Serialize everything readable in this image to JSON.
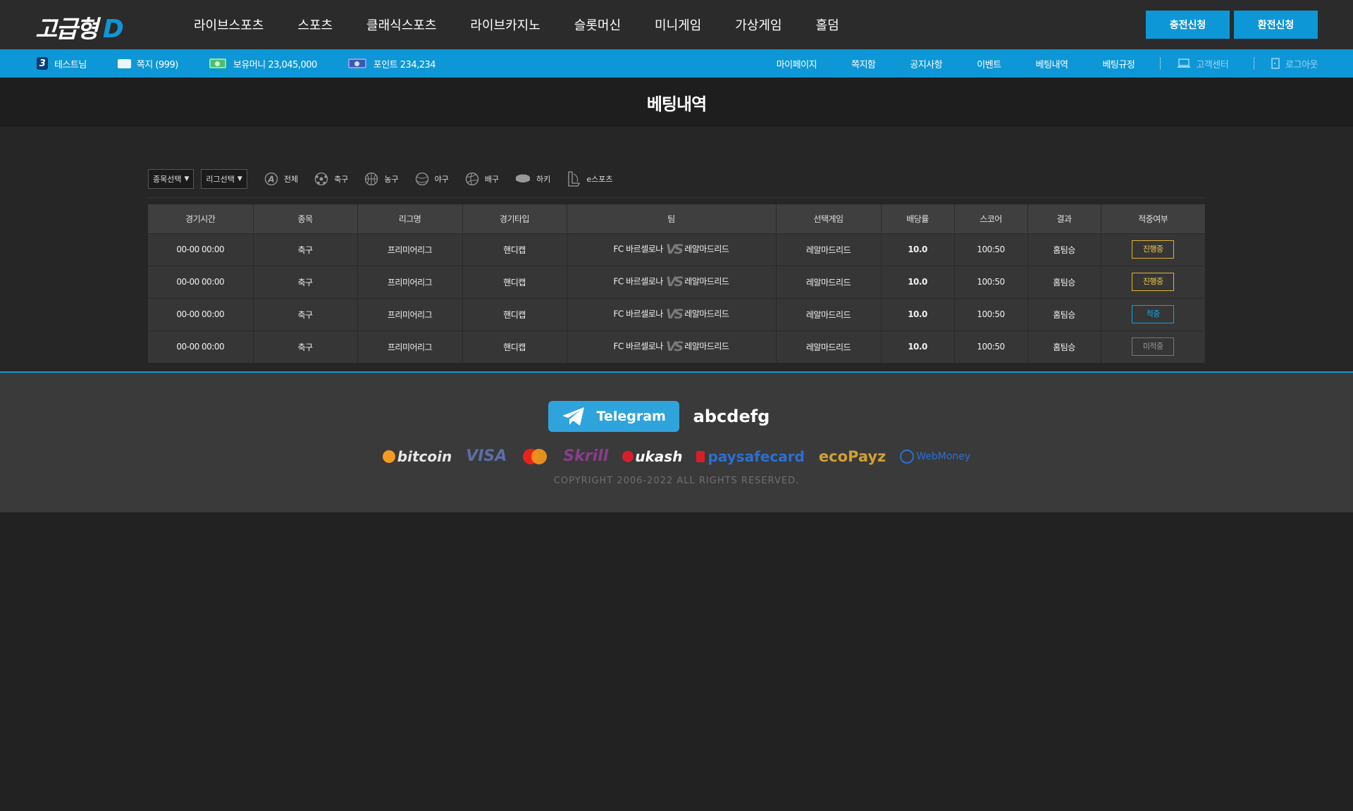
{
  "brand": {
    "logo_text": "고급형",
    "logo_letter": "D"
  },
  "main_nav": [
    "라이브스포츠",
    "스포츠",
    "클래식스포츠",
    "라이브카지노",
    "슬롯머신",
    "미니게임",
    "가상게임",
    "홀덤"
  ],
  "top_buttons": {
    "deposit": "충전신청",
    "withdraw": "환전신청"
  },
  "user_bar": {
    "level": "3",
    "username": "테스트님",
    "messages": "쪽지 (999)",
    "money": "보유머니 23,045,000",
    "points": "포인트 234,234"
  },
  "sub_nav": [
    "마이페이지",
    "쪽지함",
    "공지사항",
    "이벤트",
    "베팅내역",
    "베팅규정"
  ],
  "util_nav": {
    "support": "고객센터",
    "logout": "로그아웃"
  },
  "page_title": "베팅내역",
  "filters": {
    "sport_select": "종목선택",
    "league_select": "리그선택",
    "tabs": [
      "전체",
      "축구",
      "농구",
      "야구",
      "배구",
      "하키",
      "e스포츠"
    ]
  },
  "table": {
    "columns": [
      "경기시간",
      "종목",
      "리그명",
      "경기타입",
      "팀",
      "선택게임",
      "배당률",
      "스코어",
      "결과",
      "적중여부"
    ],
    "vs_label": "VS",
    "rows": [
      {
        "time": "00-00 00:00",
        "sport": "축구",
        "league": "프리미어리그",
        "type": "핸디캡",
        "home": "FC 바르셀로나",
        "away": "레알마드리드",
        "pick": "레알마드리드",
        "odds": "10.0",
        "score": "100:50",
        "result": "홈팀승",
        "status": "진행중",
        "status_kind": "progress"
      },
      {
        "time": "00-00 00:00",
        "sport": "축구",
        "league": "프리미어리그",
        "type": "핸디캡",
        "home": "FC 바르셀로나",
        "away": "레알마드리드",
        "pick": "레알마드리드",
        "odds": "10.0",
        "score": "100:50",
        "result": "홈팀승",
        "status": "진행중",
        "status_kind": "progress"
      },
      {
        "time": "00-00 00:00",
        "sport": "축구",
        "league": "프리미어리그",
        "type": "핸디캡",
        "home": "FC 바르셀로나",
        "away": "레알마드리드",
        "pick": "레알마드리드",
        "odds": "10.0",
        "score": "100:50",
        "result": "홈팀승",
        "status": "적중",
        "status_kind": "hit"
      },
      {
        "time": "00-00 00:00",
        "sport": "축구",
        "league": "프리미어리그",
        "type": "핸디캡",
        "home": "FC 바르셀로나",
        "away": "레알마드리드",
        "pick": "레알마드리드",
        "odds": "10.0",
        "score": "100:50",
        "result": "홈팀승",
        "status": "미적중",
        "status_kind": "miss"
      }
    ]
  },
  "footer": {
    "telegram_label": "Telegram",
    "telegram_handle": "abcdefg",
    "payments": [
      "bitcoin",
      "VISA",
      "Skrill",
      "ukash",
      "paysafecard",
      "ecoPayz",
      "WebMoney"
    ],
    "copyright": "COPYRIGHT 2006-2022 ALL RIGHTS RESERVED."
  },
  "colors": {
    "accent": "#0e97d6",
    "odds": "#12a9ee",
    "progress": "#f2c84b"
  }
}
